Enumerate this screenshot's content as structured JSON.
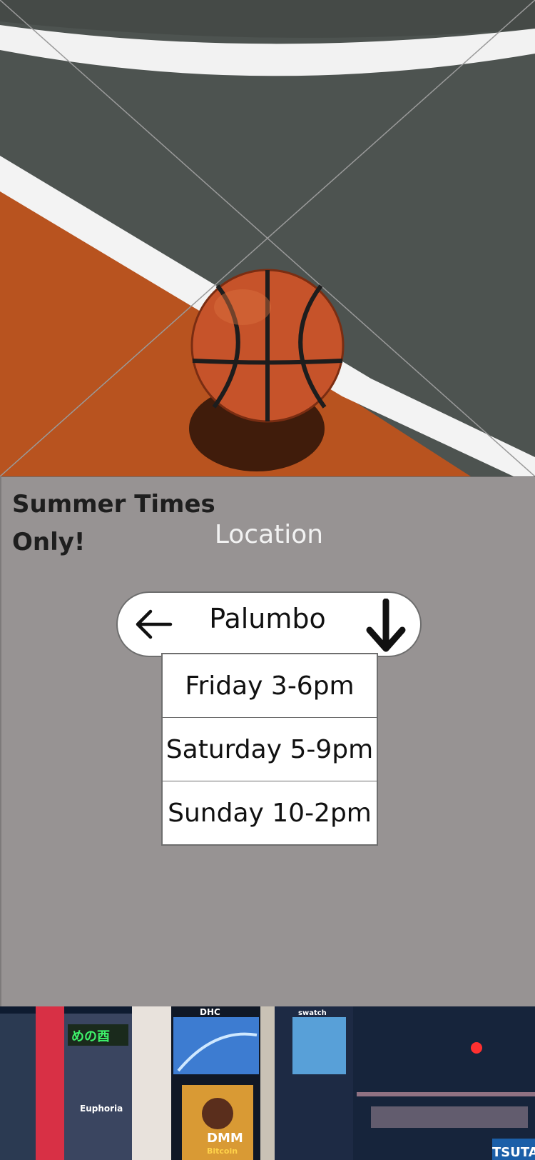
{
  "hero_image": {
    "alt_icon": "basketball-court-photo"
  },
  "promo": {
    "title_line1": "Summer Times",
    "title_line2": "Only!"
  },
  "location": {
    "label": "Location",
    "selected": "Palumbo",
    "back_icon": "arrow-left-icon",
    "dropdown_icon": "arrow-down-icon"
  },
  "times": [
    "Friday 3-6pm",
    "Saturday 5-9pm",
    "Sunday 10-2pm"
  ],
  "footer_image": {
    "signs": [
      "DHC",
      "Euphoria",
      "DMM",
      "Bitcoin",
      "swatch",
      "TSUTA"
    ]
  },
  "colors": {
    "panel_bg": "#979393",
    "court_gray": "#4e5350",
    "court_orange": "#b8531f",
    "line_white": "#f4f4f4",
    "ball_orange": "#c6532a"
  }
}
